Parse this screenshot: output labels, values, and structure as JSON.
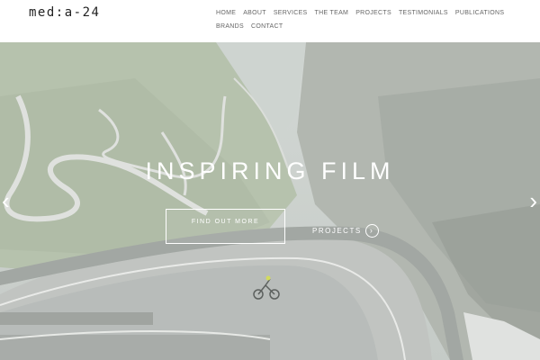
{
  "header": {
    "logo": "med:a-24",
    "nav": [
      "HOME",
      "ABOUT",
      "SERVICES",
      "THE TEAM",
      "PROJECTS",
      "TESTIMONIALS",
      "PUBLICATIONS",
      "BRANDS",
      "CONTACT"
    ]
  },
  "hero": {
    "headline": "INSPIRING FILM",
    "cta_label": "FIND OUT MORE",
    "projects_label": "PROJECTS",
    "prev_arrow": "‹",
    "next_arrow": "›",
    "projects_chevron": "›"
  }
}
